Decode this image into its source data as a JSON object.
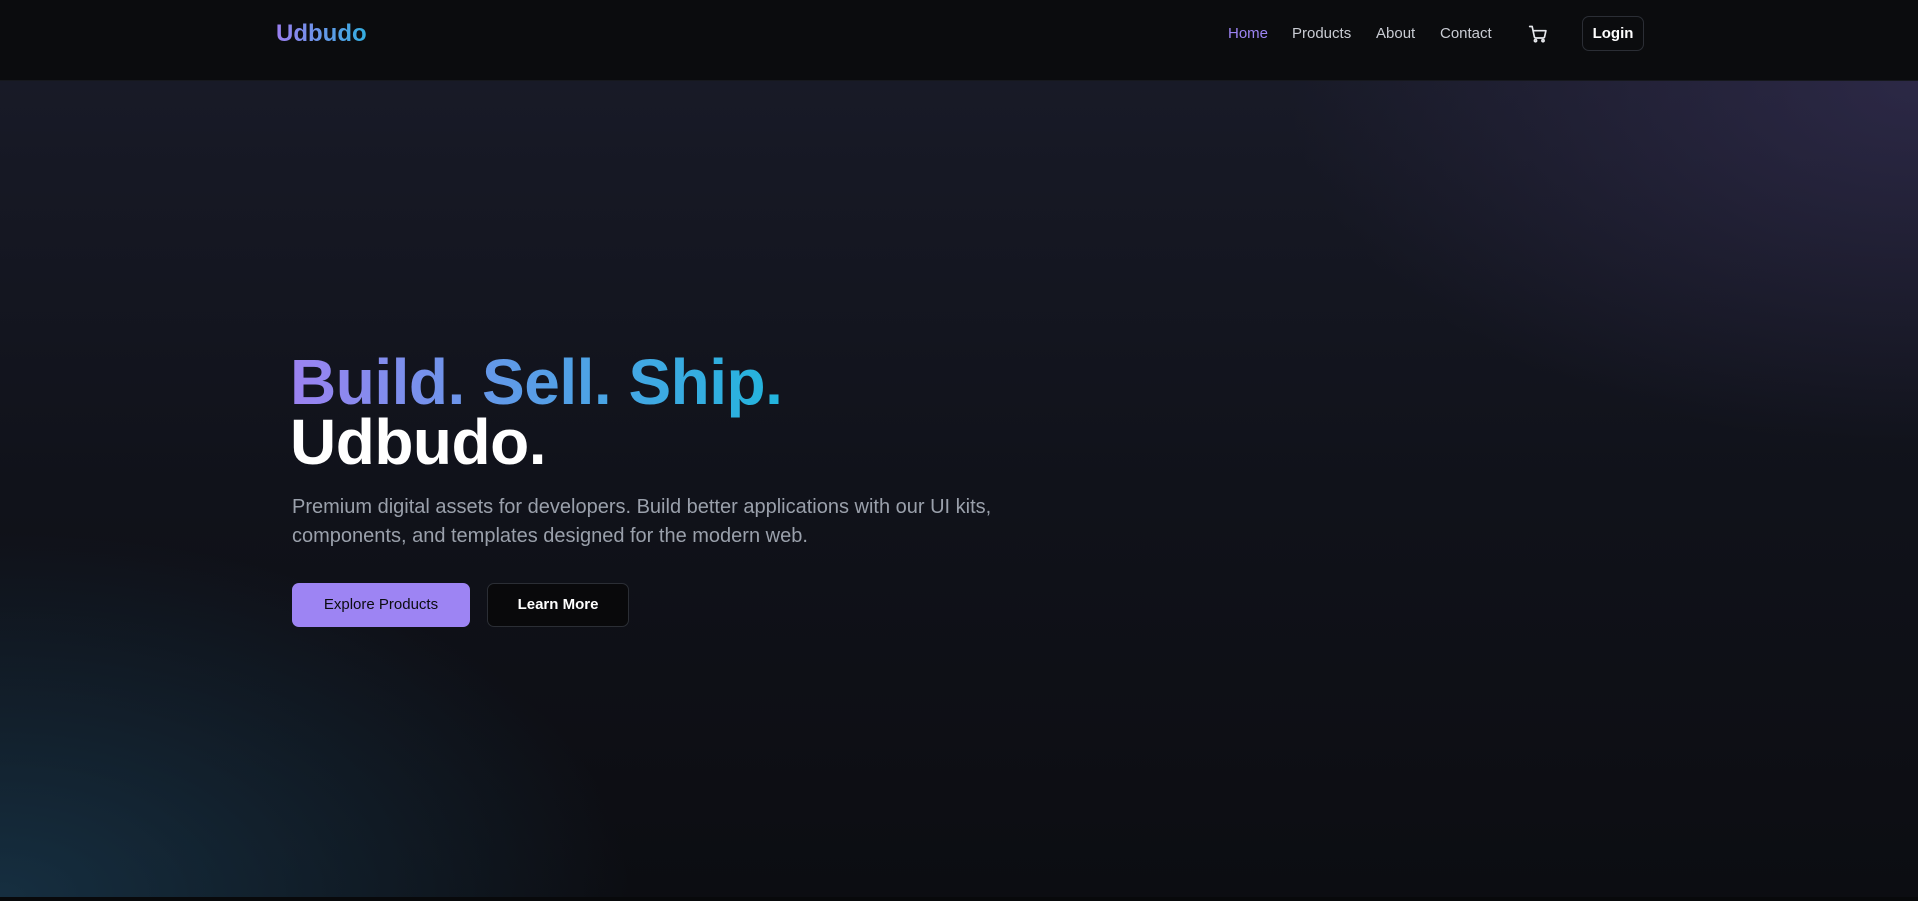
{
  "header": {
    "logo": "Udbudo",
    "nav": [
      {
        "label": "Home",
        "active": true
      },
      {
        "label": "Products",
        "active": false
      },
      {
        "label": "About",
        "active": false
      },
      {
        "label": "Contact",
        "active": false
      }
    ],
    "cart_icon": "shopping-cart-icon",
    "login_label": "Login"
  },
  "hero": {
    "headline_gradient": "Build. Sell. Ship.",
    "headline_plain": "Udbudo.",
    "subtitle": "Premium digital assets for developers. Build better applications with our UI kits, components, and templates designed for the modern web.",
    "primary_button": "Explore Products",
    "secondary_button": "Learn More"
  },
  "colors": {
    "accent": "#9d84f3",
    "gradient_start": "#9c82f1",
    "gradient_end": "#22b5dd",
    "background": "#0a0b0d",
    "text_muted": "#9aa0ab"
  }
}
